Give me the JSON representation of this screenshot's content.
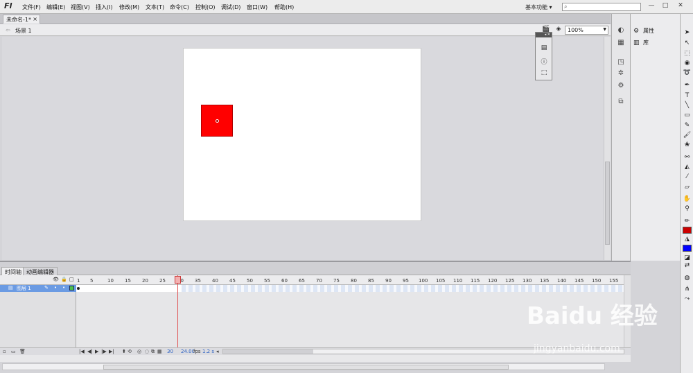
{
  "app": {
    "logo": "Fl",
    "workspace": "基本功能",
    "search_icon": "search-icon"
  },
  "menu": [
    "文件(F)",
    "编辑(E)",
    "视图(V)",
    "插入(I)",
    "修改(M)",
    "文本(T)",
    "命令(C)",
    "控制(O)",
    "调试(D)",
    "窗口(W)",
    "帮助(H)"
  ],
  "window_buttons": {
    "minimize": "—",
    "restore": "□",
    "close": "✕"
  },
  "document": {
    "tab_title": "未命名-1*",
    "tab_close": "×",
    "scene": "场景 1",
    "zoom": "100%"
  },
  "panels": {
    "properties": "属性",
    "library": "库"
  },
  "stage": {
    "background": "#ffffff",
    "shape_color": "#ff0000"
  },
  "timeline": {
    "tab_timeline": "时间轴",
    "tab_motion_editor": "动画编辑器",
    "layer_name": "图层 1",
    "ruler": [
      "1",
      "5",
      "10",
      "15",
      "20",
      "25",
      "30",
      "35",
      "40",
      "45",
      "50",
      "55",
      "60",
      "65",
      "70",
      "75",
      "80",
      "85",
      "90",
      "95",
      "100",
      "105",
      "110",
      "115",
      "120",
      "125",
      "130",
      "135",
      "140",
      "145",
      "150",
      "155"
    ],
    "current_frame": "30",
    "fps": "24.00",
    "fps_unit": "fps",
    "time": "1.2 s"
  },
  "colors": {
    "stroke": "#cc0000",
    "fill": "#0000ff"
  },
  "watermark": {
    "brand": "Baidu 经验",
    "url": "jingyanbaidu.com"
  }
}
